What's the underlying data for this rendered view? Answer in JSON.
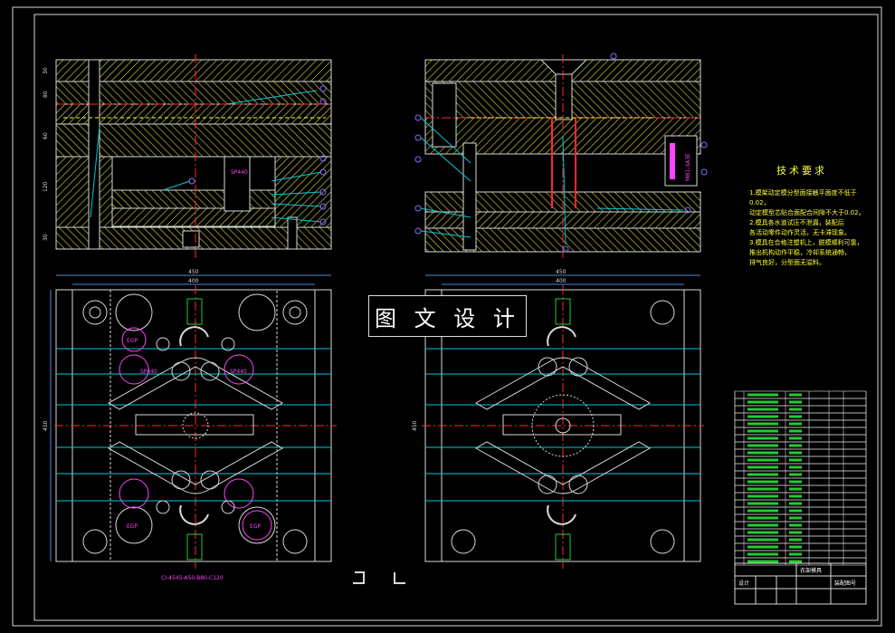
{
  "stamp": "图 文 设 计",
  "tech": {
    "title": "技术要求",
    "items": [
      "1.模架动定模分型面接触平面度不低于0.02，",
      "  动定模型芯贴合面配合间隙不大于0.02。",
      "2.模具各水道试压不泄漏，装配后",
      "  各活动零件动作灵活，无卡滞现象。",
      "3.模具在合格注塑机上，脱模顺利可靠，",
      "  推出机构动作平稳，冷却系统通畅，",
      "  排气良好，分型面无溢料。"
    ]
  },
  "dims": {
    "left_overall": "450",
    "left_inner": "400",
    "right_overall": "450",
    "right_inner": "400",
    "left_height": "450",
    "right_height": "450",
    "side_30a": "30",
    "side_80": "80",
    "side_60": "60",
    "side_120": "120",
    "side_30b": "30"
  },
  "labels": {
    "sp_side": "SP440",
    "sp_right": "MB1-3A3E",
    "spc_left": "SP440",
    "spc_right": "SP440",
    "egp_tl": "EGP",
    "egp_bl": "EGP",
    "egp_br": "EGP",
    "mold_base": "CI-4545-A50-B80-C120"
  },
  "title_block": {
    "part_name": "衣架模具",
    "drawing_no": "装配图号",
    "designer": "设计"
  },
  "bom": {
    "rows": 24
  },
  "colors": {
    "hatch": "#d9d94a",
    "outline": "#d9d9d9",
    "centerline": "#ff2a2a",
    "dimension": "#4a8ad9",
    "water": "#00c9d9",
    "part": "#ff66ff",
    "green": "#22cc33",
    "stamp_bg": "#000000"
  }
}
